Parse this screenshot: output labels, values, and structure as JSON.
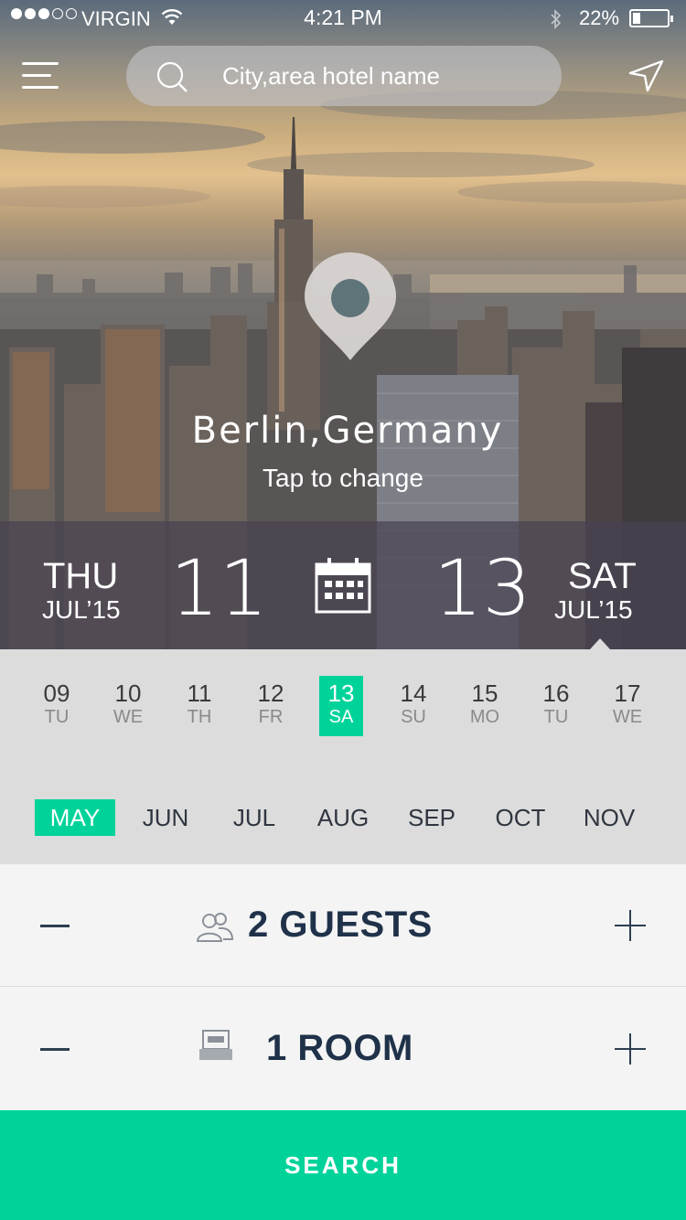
{
  "status_bar": {
    "carrier": "VIRGIN",
    "time": "4:21 PM",
    "battery": "22%"
  },
  "header": {
    "search_placeholder": "City,area hotel name"
  },
  "location": {
    "city": "Berlin,Germany",
    "hint": "Tap to change"
  },
  "dates": {
    "checkin": {
      "dow": "THU",
      "month": "JUL’15",
      "day": "11"
    },
    "checkout": {
      "dow": "SAT",
      "month": "JUL’15",
      "day": "13"
    }
  },
  "calendar": {
    "days": [
      {
        "n": "09",
        "w": "TU"
      },
      {
        "n": "10",
        "w": "WE"
      },
      {
        "n": "11",
        "w": "TH"
      },
      {
        "n": "12",
        "w": "FR"
      },
      {
        "n": "13",
        "w": "SA"
      },
      {
        "n": "14",
        "w": "SU"
      },
      {
        "n": "15",
        "w": "MO"
      },
      {
        "n": "16",
        "w": "TU"
      },
      {
        "n": "17",
        "w": "WE"
      }
    ],
    "selected_day": "13",
    "months": [
      "MAY",
      "JUN",
      "JUL",
      "AUG",
      "SEP",
      "OCT",
      "NOV"
    ],
    "selected_month": "MAY"
  },
  "guests": {
    "label": "2 GUESTS"
  },
  "rooms": {
    "label": "1 ROOM"
  },
  "search_button": {
    "label": "SEARCH"
  },
  "colors": {
    "accent": "#00d39a",
    "navy": "#1f3249",
    "calendar_bg": "#dcdcdc"
  },
  "icons": [
    "menu-icon",
    "search-icon",
    "navigation-arrow-icon",
    "location-pin-icon",
    "calendar-icon",
    "guests-icon",
    "bed-icon",
    "wifi-icon",
    "bluetooth-icon",
    "battery-icon"
  ]
}
